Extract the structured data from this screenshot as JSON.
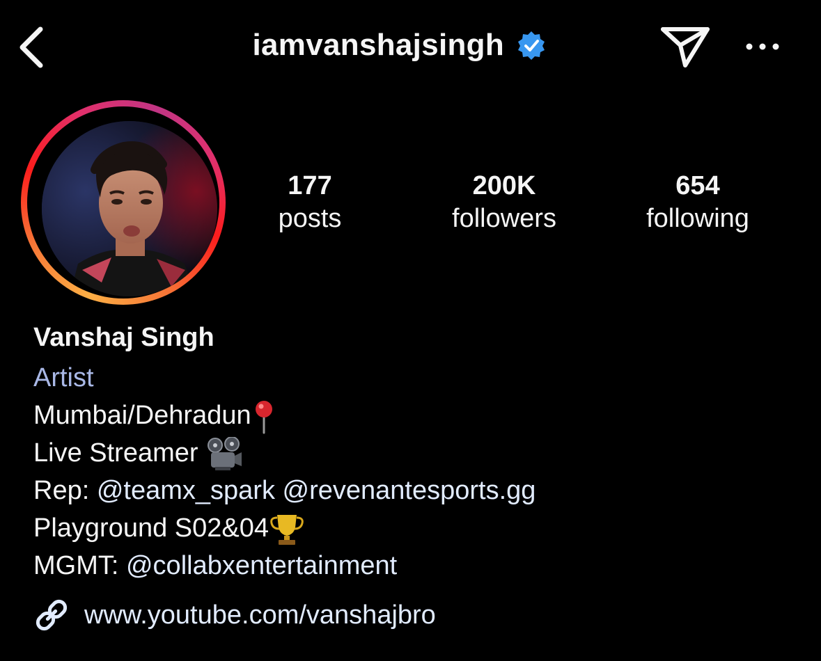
{
  "header": {
    "username": "iamvanshajsingh",
    "verified_badge_color": "#3897f0"
  },
  "stats": {
    "posts": {
      "count": "177",
      "label": "posts"
    },
    "followers": {
      "count": "200K",
      "label": "followers"
    },
    "following": {
      "count": "654",
      "label": "following"
    }
  },
  "profile": {
    "name": "Vanshaj Singh",
    "category": "Artist",
    "bio": {
      "location": "Mumbai/Dehradun",
      "streamer": "Live Streamer",
      "rep_prefix": "Rep: ",
      "rep_mention_1": "@teamx_spark",
      "rep_mention_2": "@revenantesports.gg",
      "playground": "Playground S02&04",
      "mgmt_prefix": "MGMT: ",
      "mgmt_mention": "@collabxentertainment"
    },
    "link": "www.youtube.com/vanshajbro"
  },
  "icons": {
    "back": "chevron-left-icon",
    "verified": "verified-badge-icon",
    "send": "paper-plane-icon",
    "more": "more-dots-icon",
    "location_emoji": "round-pushpin-icon",
    "streamer_emoji": "film-projector-icon",
    "trophy_emoji": "trophy-icon",
    "link": "link-icon"
  },
  "colors": {
    "background": "#000000",
    "text": "#f5f5f5",
    "category": "#a9b8e6",
    "mention": "#e2ecff"
  }
}
